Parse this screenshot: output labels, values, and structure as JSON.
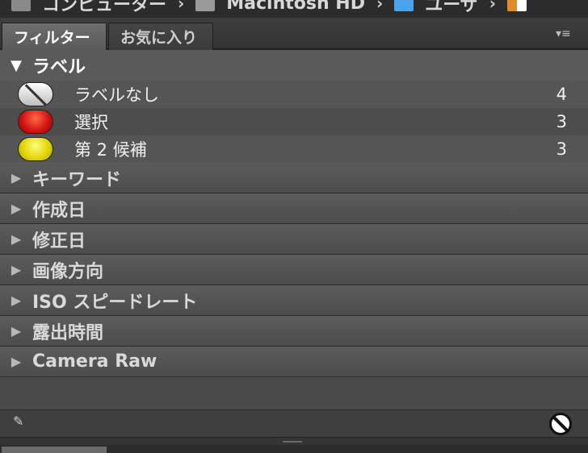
{
  "breadcrumb": {
    "items": [
      {
        "icon": "folder-icon",
        "label": "コンピューター"
      },
      {
        "icon": "disk-icon",
        "label": "Macintosh HD"
      },
      {
        "icon": "folder-blue-icon",
        "label": "ユーザ"
      },
      {
        "icon": "home-icon",
        "label": ""
      }
    ]
  },
  "tabs": [
    {
      "label": "フィルター",
      "active": true
    },
    {
      "label": "お気に入り",
      "active": false
    }
  ],
  "menu_icon": "panel-menu-icon",
  "filter": {
    "label_section": {
      "title": "ラベル",
      "expanded": true,
      "rows": [
        {
          "label": "ラベルなし",
          "count": "4",
          "swatch": "none"
        },
        {
          "label": "選択",
          "count": "3",
          "swatch": "red"
        },
        {
          "label": "第 2 候補",
          "count": "3",
          "swatch": "yellow"
        }
      ]
    },
    "sections": [
      {
        "title": "キーワード"
      },
      {
        "title": "作成日"
      },
      {
        "title": "修正日"
      },
      {
        "title": "画像方向"
      },
      {
        "title": "ISO スピードレート"
      },
      {
        "title": "露出時間"
      },
      {
        "title": "Camera Raw"
      }
    ]
  },
  "colors": {
    "panel_bg": "#505050",
    "label_red": "#d01010",
    "label_yellow": "#e0d400"
  }
}
